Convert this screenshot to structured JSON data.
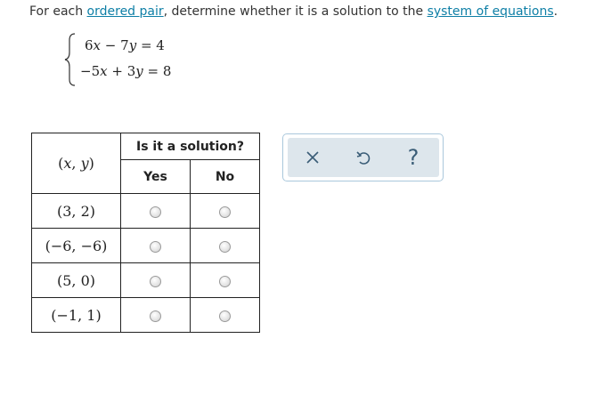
{
  "prompt": {
    "before": "For each ",
    "link1": "ordered pair",
    "middle": ", determine whether it is a solution to the ",
    "link2": "system of equations",
    "after": "."
  },
  "system": {
    "eq1": {
      "a": "6",
      "x": "x",
      "op": "−",
      "b": "7",
      "y": "y",
      "rhs": "= 4"
    },
    "eq2": {
      "a": "−5",
      "x": "x",
      "op": "+",
      "b": "3",
      "y": "y",
      "rhs": "= 8"
    }
  },
  "table": {
    "header_question": "Is it a solution?",
    "pair_header": {
      "open": "(",
      "x": "x",
      "sep": ", ",
      "y": "y",
      "close": ")"
    },
    "col_yes": "Yes",
    "col_no": "No",
    "rows": [
      {
        "pair": "(3, 2)",
        "yes_selected": false,
        "no_selected": false
      },
      {
        "pair": "(−6, −6)",
        "yes_selected": false,
        "no_selected": false
      },
      {
        "pair": "(5, 0)",
        "yes_selected": false,
        "no_selected": false
      },
      {
        "pair": "(−1, 1)",
        "yes_selected": false,
        "no_selected": false
      }
    ]
  },
  "toolbox": {
    "close_icon": "x-icon",
    "undo_icon": "undo-icon",
    "help_label": "?"
  },
  "colors": {
    "link": "#0e7fa6",
    "toolbox_bg": "#dde6ec",
    "toolbox_border": "#aac8dc",
    "icon": "#3a5d77"
  }
}
